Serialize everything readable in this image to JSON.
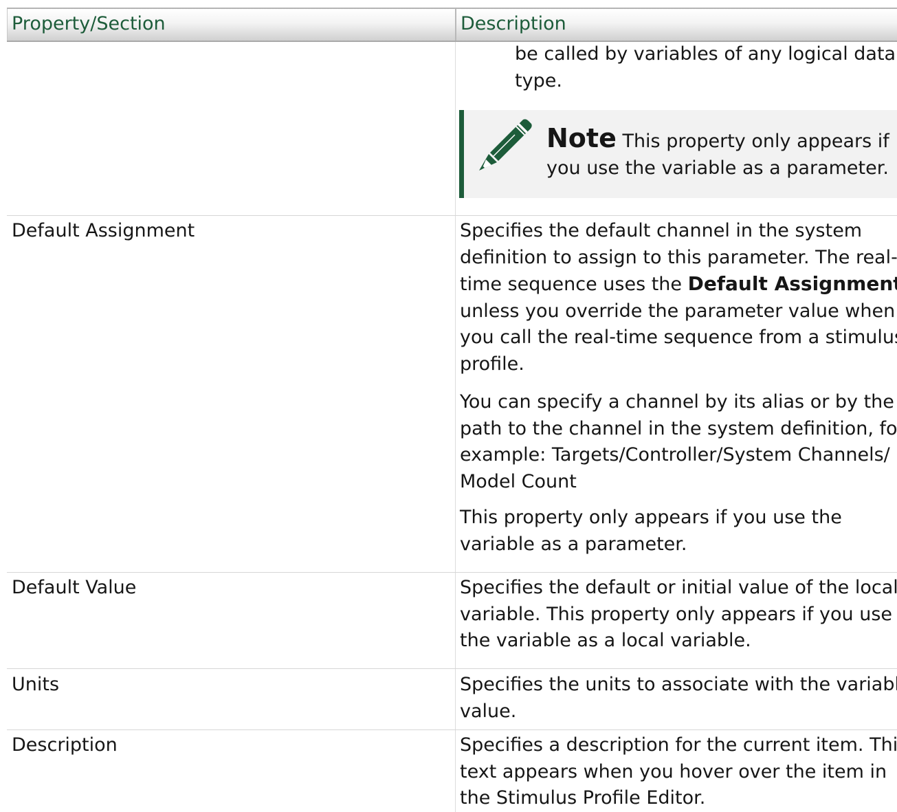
{
  "table": {
    "header": {
      "col1": "Property/Section",
      "col2": "Description"
    },
    "carry_over": {
      "line1": "be called by variables of any logical data",
      "line2": "type."
    },
    "note": {
      "label": "Note",
      "line1": "This property only appears if",
      "line2": "you use the variable as a parameter."
    },
    "rows": {
      "default_assignment": {
        "name": "Default Assignment",
        "p1_l1": "Specifies the default channel in the system",
        "p1_l2": "definition to assign to this parameter. The real-",
        "p1_l3_pre": "time sequence uses the ",
        "p1_l3_bold": "Default Assignment",
        "p1_l4": "unless you override the parameter value when",
        "p1_l5": "you call the real-time sequence from a stimulus",
        "p1_l6": "profile.",
        "p2_l1": "You can specify a channel by its alias or by the",
        "p2_l2": "path to the channel in the system definition, for",
        "p2_l3": "example: Targets/Controller/System Channels/",
        "p2_l4": "Model Count",
        "p3_l1": "This property only appears if you use the",
        "p3_l2": "variable as a parameter."
      },
      "default_value": {
        "name": "Default Value",
        "l1": "Specifies the default or initial value of the local",
        "l2": "variable. This property only appears if you use",
        "l3": "the variable as a local variable."
      },
      "units": {
        "name": "Units",
        "l1": "Specifies the units to associate with the variable",
        "l2": "value."
      },
      "description": {
        "name": "Description",
        "l1": "Specifies a description for the current item. This",
        "l2": "text appears when you hover over the item in",
        "l3": "the Stimulus Profile Editor."
      }
    }
  }
}
